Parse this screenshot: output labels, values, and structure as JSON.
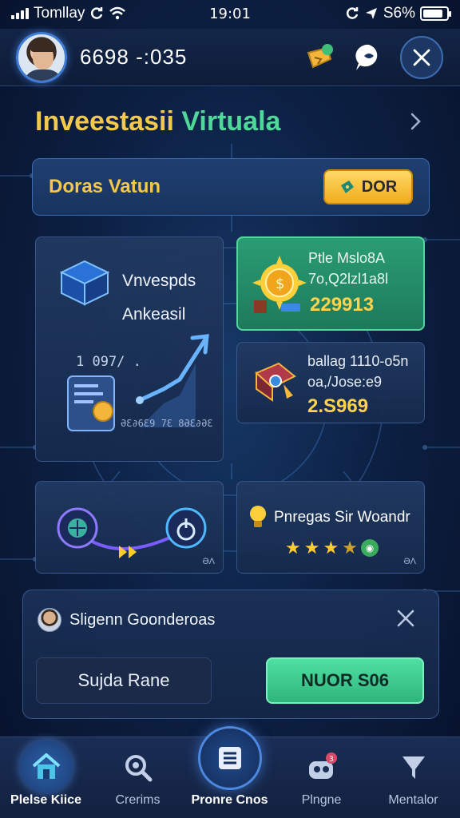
{
  "status_bar": {
    "carrier": "Tomllay",
    "time": "19:01",
    "battery": "S6%",
    "battery_level": 0.86
  },
  "header": {
    "user_id": "6698 -:035",
    "icons": [
      "avatar",
      "gift-icon",
      "chat-bubble-icon",
      "close-icon"
    ]
  },
  "page": {
    "title_part1": "Inveestasii",
    "title_part2": "Virtuala"
  },
  "bonus": {
    "label": "Doras Vatun",
    "button_label": "DOR"
  },
  "cards": {
    "invest": {
      "line1": "Vnvespds",
      "line2": "Ankeasil",
      "code": "1 097/ .",
      "sub": "ƏƐ∂6Ɛ9 7Ɛ 8ƏƐ∂ƏƐ"
    },
    "top_right": {
      "line1": "Ptle Mslo8A",
      "line2": "7o,Q2lzl1a8l",
      "value": "229913"
    },
    "mid_right": {
      "line1": "ballag 1110-o5n",
      "line2": "oa,/Jose:e9",
      "value": "2.S969"
    },
    "bot_left": {
      "corner": "ƏΛ"
    },
    "bot_right": {
      "label": "Pnregas Sir Woandr",
      "stars_value": 3.5,
      "stars_max": 5,
      "corner": "ƏΛ"
    }
  },
  "notification": {
    "title": "Sligenn Goonderoas",
    "dismiss_label": "Sujda Rane",
    "confirm_label": "NUOR S06"
  },
  "nav": {
    "items": [
      {
        "label": "Plelse Kiice",
        "icon": "home-icon"
      },
      {
        "label": "Crerims",
        "icon": "search-icon"
      },
      {
        "label": "Pronre Cnos",
        "icon": "list-icon"
      },
      {
        "label": "Plngne",
        "icon": "robot-icon"
      },
      {
        "label": "Mentalor",
        "icon": "funnel-icon"
      }
    ]
  },
  "colors": {
    "accent_gold": "#f2c94c",
    "accent_green": "#4fd89a",
    "bg": "#0d2145"
  }
}
